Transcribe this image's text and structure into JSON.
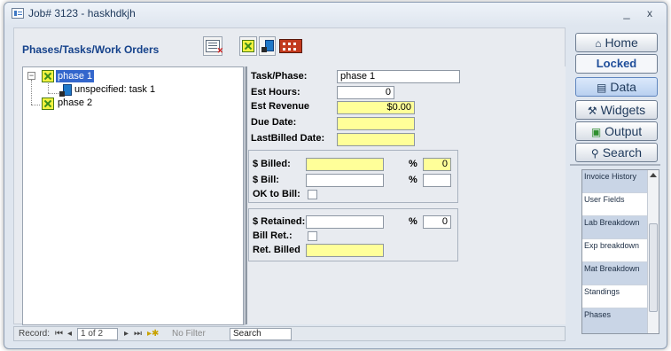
{
  "window": {
    "title": "Job# 3123 - haskhdkjh",
    "minimize": "_",
    "close": "x"
  },
  "section": {
    "title": "Phases/Tasks/Work Orders"
  },
  "toolbar": {
    "icons": [
      "delete-item-icon",
      "add-phase-icon",
      "add-task-icon",
      "add-work-order-icon"
    ]
  },
  "tree": {
    "items": [
      {
        "label": "phase 1",
        "level": 0,
        "expander": "−",
        "selected": true,
        "icon": "phase-icon"
      },
      {
        "label": "unspecified: task 1",
        "level": 1,
        "selected": false,
        "icon": "task-icon"
      },
      {
        "label": "phase 2",
        "level": 0,
        "selected": false,
        "icon": "phase-icon"
      }
    ]
  },
  "details": {
    "task_phase_label": "Task/Phase:",
    "task_phase_value": "phase 1",
    "est_hours_label": "Est Hours:",
    "est_hours_value": "0",
    "est_revenue_label": "Est Revenue",
    "est_revenue_value": "$0.00",
    "due_date_label": "Due Date:",
    "due_date_value": "",
    "last_billed_label": "LastBilled Date:",
    "last_billed_value": "",
    "billed_label": "$ Billed:",
    "billed_value": "",
    "billed_pct_label": "%",
    "billed_pct_value": "0",
    "bill_label": "$ Bill:",
    "bill_value": "",
    "bill_pct_label": "%",
    "bill_pct_value": "",
    "ok_to_bill_label": "OK to Bill:",
    "retained_label": "$ Retained:",
    "retained_value": "",
    "retained_pct_label": "%",
    "retained_pct_value": "0",
    "bill_ret_label": "Bill Ret.:",
    "ret_billed_label": "Ret. Billed",
    "ret_billed_value": ""
  },
  "statusbar": {
    "record_label": "Record:",
    "first": "⏮",
    "prev": "◂",
    "position": "1 of 2",
    "next": "▸",
    "last": "⏭",
    "new": "▸✱",
    "filter": "No Filter",
    "search": "Search"
  },
  "nav": {
    "home": "Home",
    "locked": "Locked",
    "data": "Data",
    "widgets": "Widgets",
    "output": "Output",
    "search": "Search"
  },
  "list": {
    "items": [
      "Invoice History",
      "User Fields",
      "Lab Breakdown",
      "Exp breakdown",
      "Mat Breakdown",
      "Standings",
      "Phases"
    ]
  }
}
